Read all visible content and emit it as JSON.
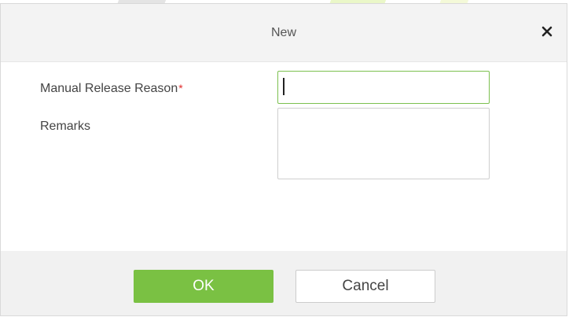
{
  "dialog": {
    "title": "New",
    "close_icon": "close-icon"
  },
  "form": {
    "reason": {
      "label": "Manual Release Reason",
      "required_marker": "*",
      "value": ""
    },
    "remarks": {
      "label": "Remarks",
      "value": ""
    }
  },
  "footer": {
    "ok_label": "OK",
    "cancel_label": "Cancel"
  },
  "colors": {
    "primary": "#7ac143",
    "required": "#e02c2c",
    "focus_border": "#7cc04f"
  }
}
